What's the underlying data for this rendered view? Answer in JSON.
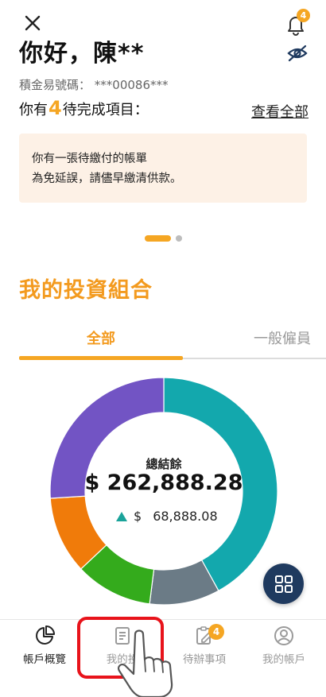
{
  "header": {
    "greeting": "你好，陳**",
    "notification_count": "4",
    "account_label": "積金易號碼：",
    "account_number": "***00086***",
    "pending_prefix": "你有",
    "pending_count": "4",
    "pending_suffix": "待完成項目：",
    "view_all": "查看全部"
  },
  "notice": {
    "line1": "你有一張待繳付的帳單",
    "line2": "為免延誤，請儘早繳清供款。"
  },
  "portfolio": {
    "title": "我的投資組合",
    "tabs": [
      {
        "label": "全部",
        "active": true
      },
      {
        "label": "一般僱員",
        "active": false
      }
    ],
    "center_label": "總結餘",
    "total": "$ 262,888.28",
    "change_currency": "$",
    "change_amount": "68,888.08",
    "segments": [
      {
        "color": "#13a8ad",
        "share": 0.42
      },
      {
        "color": "#6b7b86",
        "share": 0.1
      },
      {
        "color": "#34ab1c",
        "share": 0.11
      },
      {
        "color": "#f07b0a",
        "share": 0.11
      },
      {
        "color": "#7254c4",
        "share": 0.26
      }
    ]
  },
  "bottom_nav": [
    {
      "label": "帳戶概覽",
      "icon": "pie-chart-icon",
      "active": true
    },
    {
      "label": "我的投",
      "icon": "document-icon",
      "active": false
    },
    {
      "label": "待辦事項",
      "icon": "clipboard-edit-icon",
      "active": false,
      "badge": "4"
    },
    {
      "label": "我的帳戶",
      "icon": "user-circle-icon",
      "active": false
    }
  ],
  "colors": {
    "accent": "#f5a623",
    "highlight": "#e8131b",
    "fab": "#1f3a5f"
  }
}
